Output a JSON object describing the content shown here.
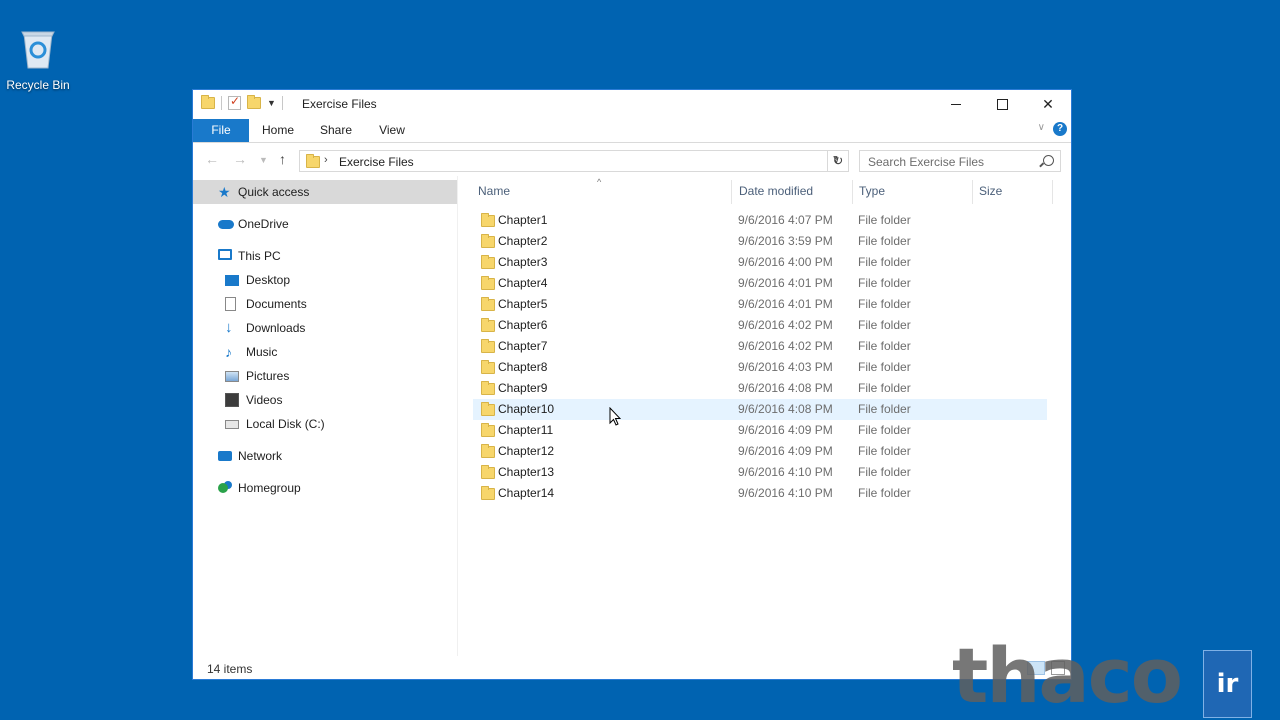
{
  "desktop": {
    "icons": [
      {
        "label": "Recycle Bin",
        "icon": "recycle-bin-icon"
      }
    ]
  },
  "window": {
    "title": "Exercise Files",
    "controls": {
      "minimize": "minimize",
      "maximize": "maximize",
      "close": "close"
    }
  },
  "ribbon": {
    "tabs": [
      {
        "label": "File",
        "active": true
      },
      {
        "label": "Home"
      },
      {
        "label": "Share"
      },
      {
        "label": "View"
      }
    ],
    "help_label": "?"
  },
  "address": {
    "path": [
      "Exercise Files"
    ],
    "search_placeholder": "Search Exercise Files"
  },
  "nav_pane": {
    "items": [
      {
        "label": "Quick access",
        "icon": "star-icon",
        "selected": true
      },
      {
        "label": "OneDrive",
        "icon": "cloud-icon"
      },
      {
        "label": "This PC",
        "icon": "computer-icon"
      },
      {
        "label": "Desktop",
        "icon": "desktop-icon"
      },
      {
        "label": "Documents",
        "icon": "documents-icon"
      },
      {
        "label": "Downloads",
        "icon": "download-icon"
      },
      {
        "label": "Music",
        "icon": "music-icon"
      },
      {
        "label": "Pictures",
        "icon": "pictures-icon"
      },
      {
        "label": "Videos",
        "icon": "videos-icon"
      },
      {
        "label": "Local Disk (C:)",
        "icon": "disk-icon"
      },
      {
        "label": "Network",
        "icon": "network-icon"
      },
      {
        "label": "Homegroup",
        "icon": "homegroup-icon"
      }
    ]
  },
  "file_list": {
    "columns": {
      "name": "Name",
      "date": "Date modified",
      "type": "Type",
      "size": "Size"
    },
    "sorted_by": "Name",
    "rows": [
      {
        "name": "Chapter1",
        "date": "9/6/2016 4:07 PM",
        "type": "File folder"
      },
      {
        "name": "Chapter2",
        "date": "9/6/2016 3:59 PM",
        "type": "File folder"
      },
      {
        "name": "Chapter3",
        "date": "9/6/2016 4:00 PM",
        "type": "File folder"
      },
      {
        "name": "Chapter4",
        "date": "9/6/2016 4:01 PM",
        "type": "File folder"
      },
      {
        "name": "Chapter5",
        "date": "9/6/2016 4:01 PM",
        "type": "File folder"
      },
      {
        "name": "Chapter6",
        "date": "9/6/2016 4:02 PM",
        "type": "File folder"
      },
      {
        "name": "Chapter7",
        "date": "9/6/2016 4:02 PM",
        "type": "File folder"
      },
      {
        "name": "Chapter8",
        "date": "9/6/2016 4:03 PM",
        "type": "File folder"
      },
      {
        "name": "Chapter9",
        "date": "9/6/2016 4:08 PM",
        "type": "File folder"
      },
      {
        "name": "Chapter10",
        "date": "9/6/2016 4:08 PM",
        "type": "File folder",
        "hover": true
      },
      {
        "name": "Chapter11",
        "date": "9/6/2016 4:09 PM",
        "type": "File folder"
      },
      {
        "name": "Chapter12",
        "date": "9/6/2016 4:09 PM",
        "type": "File folder"
      },
      {
        "name": "Chapter13",
        "date": "9/6/2016 4:10 PM",
        "type": "File folder"
      },
      {
        "name": "Chapter14",
        "date": "9/6/2016 4:10 PM",
        "type": "File folder"
      }
    ]
  },
  "status_bar": {
    "item_count": "14 items"
  },
  "watermark": {
    "text": "thaco",
    "badge": "ir"
  },
  "colors": {
    "desktop": "#0063b1",
    "accent": "#1979ca",
    "folder": "#f7d66b",
    "hover_row": "#e5f3ff"
  }
}
